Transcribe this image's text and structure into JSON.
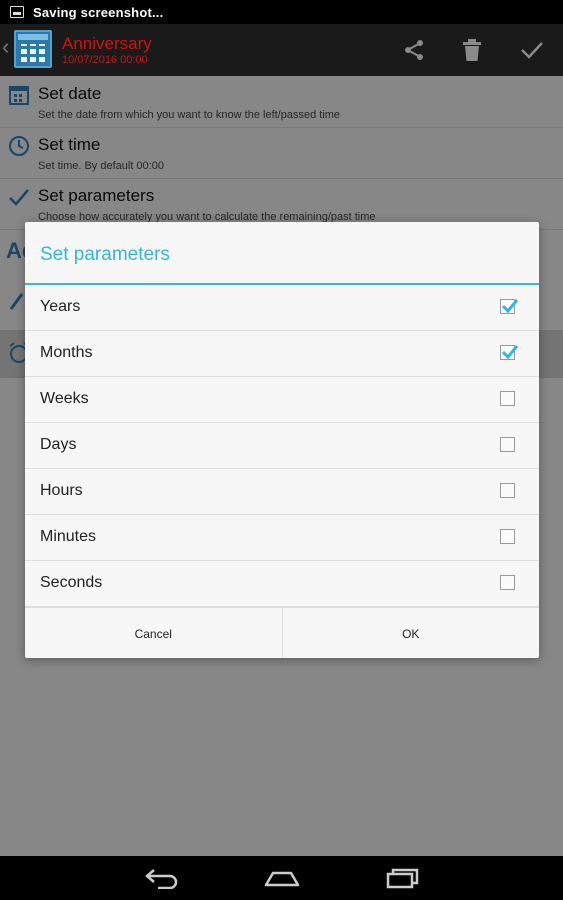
{
  "status_bar": {
    "text": "Saving screenshot..."
  },
  "action_bar": {
    "title": "Anniversary",
    "subtitle": "10/07/2016 00:00",
    "actions": [
      {
        "name": "share-button",
        "icon": "share-icon"
      },
      {
        "name": "delete-button",
        "icon": "trash-icon"
      },
      {
        "name": "done-button",
        "icon": "check-icon"
      }
    ]
  },
  "background_list": {
    "items": [
      {
        "title": "Set date",
        "summary": "Set the date from which you want to know the left/passed time",
        "icon": "calendar-icon"
      },
      {
        "title": "Set time",
        "summary": "Set time. By default 00:00",
        "icon": "clock-icon"
      },
      {
        "title": "Set parameters",
        "summary": "Choose how accurately you want to calculate the remaining/past time",
        "icon": "check-icon"
      }
    ],
    "partial_label": "Ad"
  },
  "dialog": {
    "title": "Set parameters",
    "options": [
      {
        "label": "Years",
        "checked": true
      },
      {
        "label": "Months",
        "checked": true
      },
      {
        "label": "Weeks",
        "checked": false
      },
      {
        "label": "Days",
        "checked": false
      },
      {
        "label": "Hours",
        "checked": false
      },
      {
        "label": "Minutes",
        "checked": false
      },
      {
        "label": "Seconds",
        "checked": false
      }
    ],
    "cancel_label": "Cancel",
    "ok_label": "OK"
  },
  "colors": {
    "accent": "#33b5e5",
    "title_red": "#cc1414",
    "checkbox_tick": "#33b5e5"
  }
}
